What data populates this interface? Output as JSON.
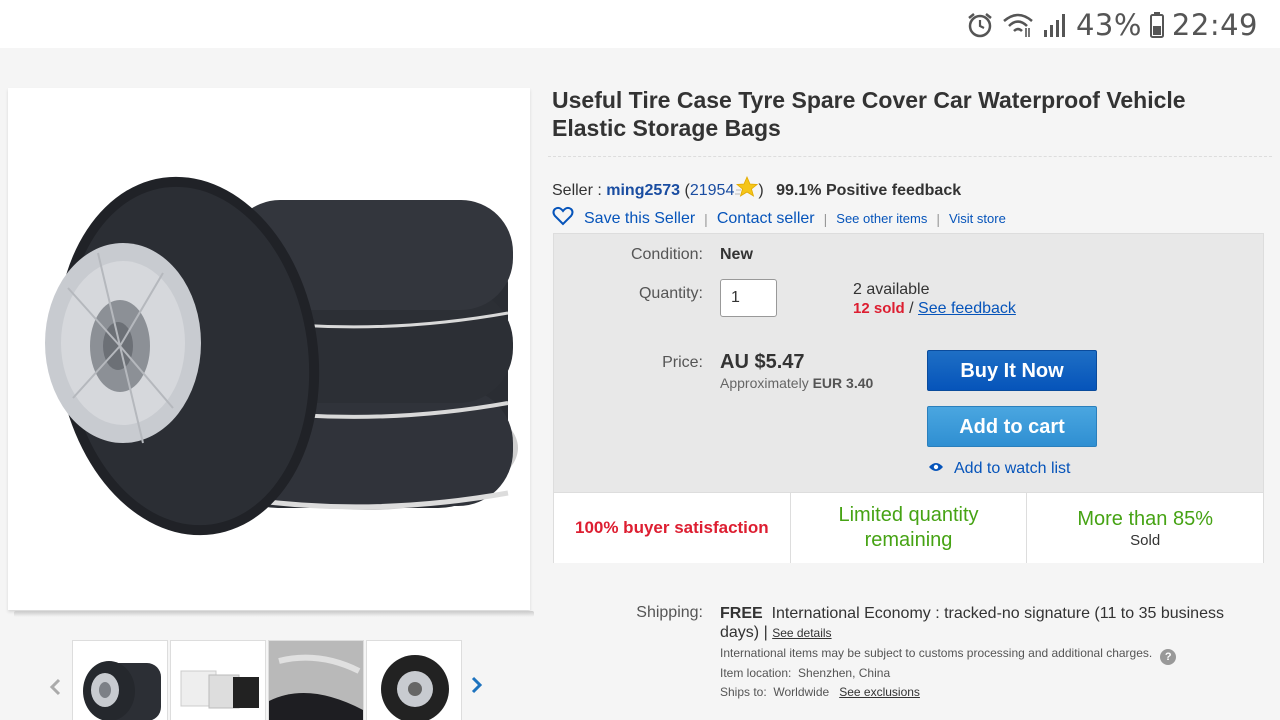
{
  "status_bar": {
    "battery": "43%",
    "time": "22:49",
    "icons": [
      "alarm-icon",
      "wifi-icon",
      "signal-icon",
      "battery-icon"
    ]
  },
  "product": {
    "title": "Useful Tire Case Tyre Spare Cover Car Waterproof Vehicle Elastic Storage Bags"
  },
  "seller": {
    "prefix": "Seller : ",
    "name": "ming2573",
    "feedback_count": "21954",
    "positive": "99.1% Positive feedback"
  },
  "actions": {
    "save_seller": "Save this Seller",
    "contact_seller": "Contact seller",
    "see_other_items": "See other items",
    "visit_store": "Visit store",
    "sep": "|"
  },
  "purchase": {
    "condition_label": "Condition:",
    "condition_value": "New",
    "quantity_label": "Quantity:",
    "quantity_value": "1",
    "available": "2 available",
    "sold": "12 sold",
    "slash": "/",
    "see_feedback": "See feedback",
    "price_label": "Price:",
    "price": "AU $5.47",
    "approx_prefix": "Approximately",
    "approx_value": "EUR 3.40",
    "buy_now": "Buy It Now",
    "add_to_cart": "Add to cart",
    "add_to_watch": "Add to watch list"
  },
  "badges": {
    "satisfaction": "100% buyer satisfaction",
    "limited_line1": "Limited quantity",
    "limited_line2": "remaining",
    "more_than": "More than 85%",
    "sold": "Sold"
  },
  "shipping": {
    "label": "Shipping:",
    "free": "FREE",
    "service": "International Economy : tracked-no signature (11 to 35 business days) |",
    "see_details": "See details",
    "customs_note": "International items may be subject to customs processing and additional charges.",
    "location_label": "Item location:",
    "location_value": "Shenzhen, China",
    "ships_label": "Ships to:",
    "ships_value": "Worldwide",
    "see_exclusions": "See exclusions",
    "help": "?"
  },
  "colors": {
    "link": "#0654ba",
    "buy_button": "#0654ba",
    "cart_button": "#3a99d8",
    "sold_red": "#dd1e31",
    "badge_green": "#46a314"
  }
}
